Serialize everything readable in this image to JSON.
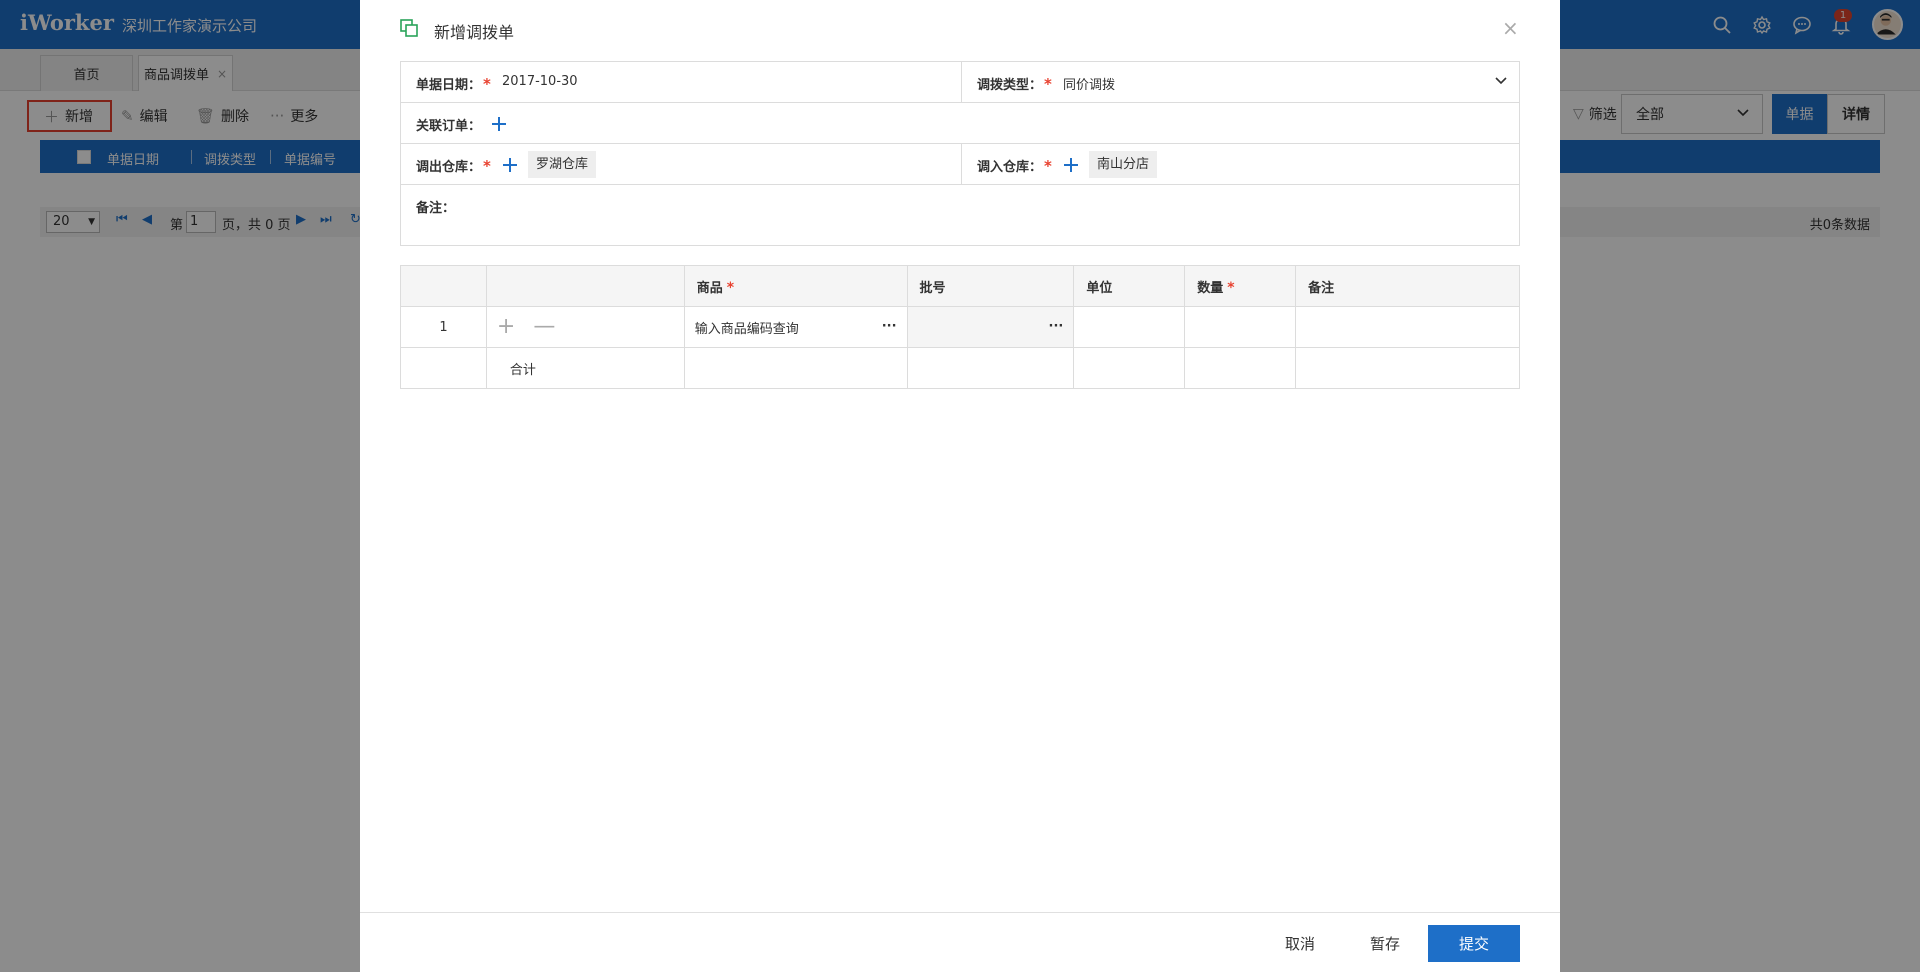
{
  "app": {
    "logo": "iWorker",
    "company": "深圳工作家演示公司",
    "notification_count": "1"
  },
  "tabs": [
    {
      "label": "首页"
    },
    {
      "label": "商品调拨单",
      "close": "×"
    }
  ],
  "toolbar": {
    "new_label": "新增",
    "edit_label": "编辑",
    "delete_label": "删除",
    "more_label": "更多",
    "filter_label": "筛选",
    "scope_value": "全部",
    "view_list_label": "单据",
    "view_detail_label": "详情"
  },
  "list": {
    "columns": [
      "单据日期",
      "调拨类型",
      "单据编号"
    ]
  },
  "pager": {
    "page_size": "20",
    "page_prefix": "第",
    "page_value": "1",
    "page_suffix": "页，共 0 页",
    "total": "共0条数据"
  },
  "modal": {
    "title": "新增调拨单",
    "close": "×",
    "form": {
      "date_label": "单据日期：",
      "date_value": "2017-10-30",
      "type_label": "调拨类型：",
      "type_value": "同价调拨",
      "related_label": "关联订单：",
      "out_label": "调出仓库：",
      "out_value": "罗湖仓库",
      "in_label": "调入仓库：",
      "in_value": "南山分店",
      "remark_label": "备注："
    },
    "grid": {
      "headers": {
        "product": "商品",
        "batch": "批号",
        "unit": "单位",
        "quantity": "数量",
        "remark": "备注"
      },
      "rows": [
        {
          "index": "1",
          "product_placeholder": "输入商品编码查询"
        }
      ],
      "total_label": "合计",
      "more_glyph": "···",
      "required_mark": "*",
      "add_glyph": "+",
      "remove_glyph": "—"
    },
    "footer": {
      "cancel": "取消",
      "save_draft": "暂存",
      "submit": "提交"
    }
  },
  "colors": {
    "primary": "#1e6fc8",
    "required": "#e8412f",
    "highlight": "#e8412f"
  }
}
